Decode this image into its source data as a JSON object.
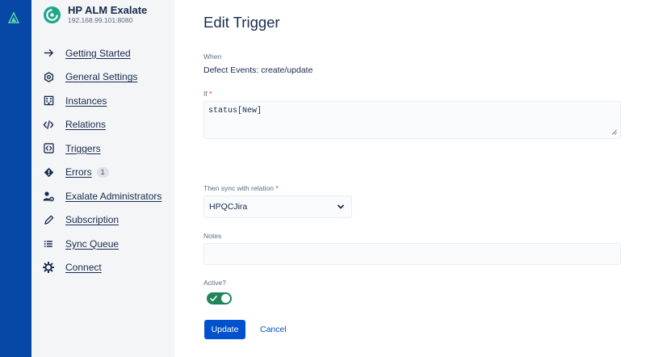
{
  "app": {
    "name": "HP ALM Exalate",
    "url": "192.168.99.101:8080"
  },
  "colors": {
    "rail": "#0747a6",
    "sidebar": "#f4f5f7",
    "accent": "#0052cc",
    "toggle_on": "#1f845a",
    "logo": "#1ea68a"
  },
  "sidebar": {
    "items": [
      {
        "label": "Getting Started",
        "icon": "arrow-right-icon"
      },
      {
        "label": "General Settings",
        "icon": "settings-hexagon-icon"
      },
      {
        "label": "Instances",
        "icon": "building-icon"
      },
      {
        "label": "Relations",
        "icon": "code-icon"
      },
      {
        "label": "Triggers",
        "icon": "code-box-icon"
      },
      {
        "label": "Errors",
        "icon": "warning-diamond-icon",
        "badge": "1"
      },
      {
        "label": "Exalate Administrators",
        "icon": "user-gear-icon"
      },
      {
        "label": "Subscription",
        "icon": "pen-icon"
      },
      {
        "label": "Sync Queue",
        "icon": "list-icon"
      },
      {
        "label": "Connect",
        "icon": "gear-icon"
      }
    ]
  },
  "form": {
    "title": "Edit Trigger",
    "when_label": "When",
    "when_value": "Defect Events: create/update",
    "if_label": "If",
    "if_value": "status[New]",
    "relation_label": "Then sync with relation",
    "relation_value": "HPQCJira",
    "notes_label": "Notes",
    "notes_value": "",
    "active_label": "Active?",
    "active": true,
    "update_label": "Update",
    "cancel_label": "Cancel",
    "required_mark": "*"
  }
}
